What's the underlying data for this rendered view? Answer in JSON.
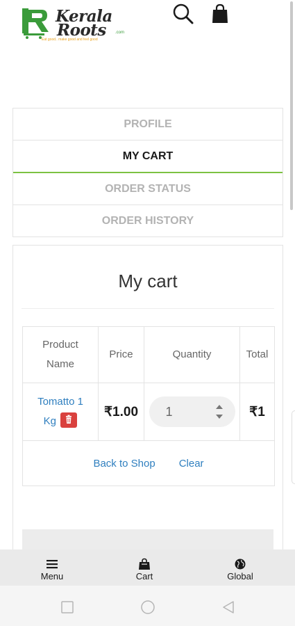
{
  "brand": {
    "line1": "Kerala",
    "line2": "Roots",
    "domain": ".com",
    "tagline": "Eat good.. make good and feel good",
    "colors": {
      "green": "#3a9b3a",
      "accent": "#7cc242",
      "orange": "#e9a11a"
    }
  },
  "header": {
    "icons": [
      "search-icon",
      "shopping-bag-icon"
    ]
  },
  "tabs": [
    {
      "label": "PROFILE",
      "active": false
    },
    {
      "label": "MY CART",
      "active": true
    },
    {
      "label": "ORDER STATUS",
      "active": false
    },
    {
      "label": "ORDER HISTORY",
      "active": false
    }
  ],
  "cart": {
    "title": "My cart",
    "columns": [
      "Product Name",
      "Price",
      "Quantity",
      "Total"
    ],
    "items": [
      {
        "name": "Tomatto 1 Kg",
        "price": "₹1.00",
        "quantity": "1",
        "total": "₹1"
      }
    ],
    "back_label": "Back to Shop",
    "clear_label": "Clear"
  },
  "bottom_nav": [
    {
      "label": "Menu",
      "icon": "menu-icon"
    },
    {
      "label": "Cart",
      "icon": "cart-bag-icon"
    },
    {
      "label": "Global",
      "icon": "globe-icon"
    }
  ],
  "system_nav": [
    "recent-apps-icon",
    "home-icon",
    "back-icon"
  ]
}
